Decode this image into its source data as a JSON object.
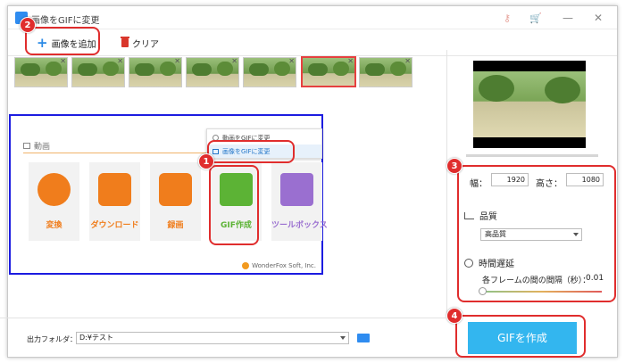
{
  "window": {
    "title": "画像をGIFに変更",
    "icons": [
      "key-icon",
      "cart-icon",
      "minimize-icon",
      "close-icon"
    ]
  },
  "toolbar": {
    "add_images": "画像を追加",
    "clear": "クリア"
  },
  "thumbnails": {
    "count": 7,
    "selected_index": 5
  },
  "embedded_screenshot": {
    "section": "動画",
    "menu": [
      "動画をGIFに変更",
      "画像をGIFに変更"
    ],
    "tiles": [
      {
        "label": "変換",
        "color": "#f07d1c"
      },
      {
        "label": "ダウンロード",
        "color": "#f07d1c"
      },
      {
        "label": "録画",
        "color": "#f07d1c"
      },
      {
        "label": "GIF作成",
        "color": "#5cb335"
      },
      {
        "label": "ツールボックス",
        "color": "#9a6fd0"
      }
    ],
    "brand": "WonderFox Soft, Inc."
  },
  "callouts": [
    "1",
    "2",
    "3",
    "4"
  ],
  "settings": {
    "width_label": "幅：",
    "width_value": "1920",
    "height_label": "高さ：",
    "height_value": "1080",
    "quality_label": "品質",
    "quality_value": "高品質",
    "delay_label": "時間遅延",
    "frame_interval_label": "各フレームの間の間隔（秒）：",
    "frame_interval_value": "0.01",
    "delay_slider_fraction": 0.0
  },
  "output": {
    "folder_label": "出力フォルダ：",
    "folder_value": "D:¥テスト"
  },
  "actions": {
    "create_gif": "GIFを作成"
  },
  "colors": {
    "callout": "#e02d2d",
    "accent": "#33b6ef",
    "highlight_box": "#1c1ce0"
  }
}
